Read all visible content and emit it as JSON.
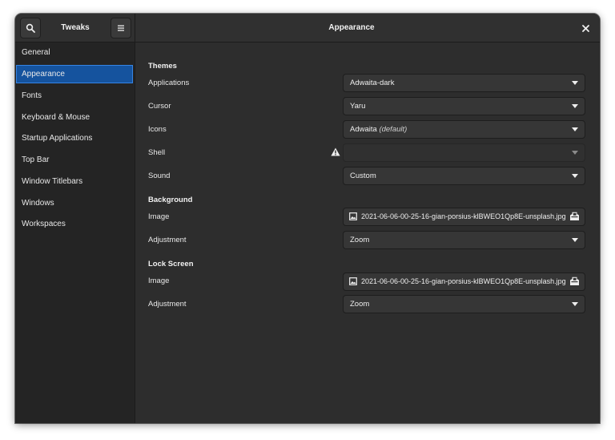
{
  "header": {
    "app_title": "Tweaks",
    "page_title": "Appearance"
  },
  "sidebar": {
    "items": [
      {
        "label": "General"
      },
      {
        "label": "Appearance"
      },
      {
        "label": "Fonts"
      },
      {
        "label": "Keyboard & Mouse"
      },
      {
        "label": "Startup Applications"
      },
      {
        "label": "Top Bar"
      },
      {
        "label": "Window Titlebars"
      },
      {
        "label": "Windows"
      },
      {
        "label": "Workspaces"
      }
    ],
    "active": "Appearance"
  },
  "themes": {
    "heading": "Themes",
    "applications": {
      "label": "Applications",
      "value": "Adwaita-dark"
    },
    "cursor": {
      "label": "Cursor",
      "value": "Yaru"
    },
    "icons": {
      "label": "Icons",
      "value": "Adwaita",
      "suffix": "(default)"
    },
    "shell": {
      "label": "Shell",
      "value": ""
    },
    "sound": {
      "label": "Sound",
      "value": "Custom"
    }
  },
  "background": {
    "heading": "Background",
    "image": {
      "label": "Image",
      "value": "2021-06-06-00-25-16-gian-porsius-klBWEO1Qp8E-unsplash.jpg"
    },
    "adjustment": {
      "label": "Adjustment",
      "value": "Zoom"
    }
  },
  "lock_screen": {
    "heading": "Lock Screen",
    "image": {
      "label": "Image",
      "value": "2021-06-06-00-25-16-gian-porsius-klBWEO1Qp8E-unsplash.jpg"
    },
    "adjustment": {
      "label": "Adjustment",
      "value": "Zoom"
    }
  },
  "icons": {
    "search": "search-icon",
    "menu": "hamburger-menu-icon",
    "close": "close-icon",
    "warning": "warning-icon",
    "image": "image-file-icon",
    "open": "open-file-icon"
  },
  "colors": {
    "accent": "#15539e",
    "accent_border": "#3584e4",
    "window_bg": "#2d2d2d",
    "sidebar_bg": "#242424"
  }
}
